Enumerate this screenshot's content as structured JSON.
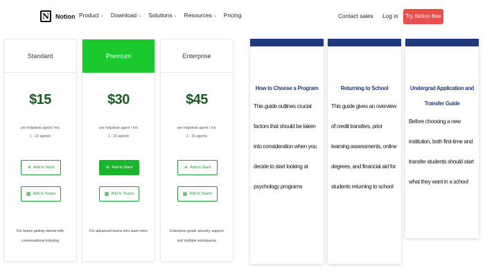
{
  "nav": {
    "logo_text": "Notion",
    "logo_glyph": "N",
    "menu": [
      {
        "label": "Product",
        "has_dropdown": true
      },
      {
        "label": "Download",
        "has_dropdown": true
      },
      {
        "label": "Solutions",
        "has_dropdown": true
      },
      {
        "label": "Resources",
        "has_dropdown": true
      },
      {
        "label": "Pricing",
        "has_dropdown": false
      }
    ],
    "chevron": "⌄",
    "contact_sales": "Contact sales",
    "login": "Log in",
    "cta": "Try Notion free"
  },
  "plans": [
    {
      "name": "Standard",
      "price": "$15",
      "sub_line1": "per helpdesk agent / mo",
      "sub_line2": "1 - 15 agents",
      "slack_label": "Add to Slack",
      "teams_label": "Add to Teams",
      "description": "For teams getting started with conversational ticketing"
    },
    {
      "name": "Premium",
      "price": "$30",
      "sub_line1": "per helpdesk agent / mo",
      "sub_line2": "1 - 15 agents",
      "slack_label": "Add to Slack",
      "teams_label": "Add to Teams",
      "description": "For advanced teams who want more"
    },
    {
      "name": "Enterprise",
      "price": "$45",
      "sub_line1": "per helpdesk agent / mo",
      "sub_line2": "1 - 15 agents",
      "slack_label": "Add to Slack",
      "teams_label": "Add to Teams",
      "description": "Enterprise-grade security, support and multiple workspaces"
    }
  ],
  "guides": [
    {
      "title": "How to Choose a Program",
      "body": "This guide outlines crucial factors that should be taken into consideration when you decide to start looking at psychology programs"
    },
    {
      "title": "Returning to School",
      "body": "This guide gives an overview of credit transfers, prior learning assessments, online degrees, and financial aid for students returning to school"
    },
    {
      "title": "Undergrad Application and Transfer Guide",
      "body": "Before choosing a new institution, both first-time and transfer students should start what they want in a school"
    }
  ],
  "colors": {
    "cta": "#e8504d",
    "premium_header": "#19c92d",
    "price": "#1a5a26",
    "guide_accent": "#1f3a7a"
  },
  "icons": {
    "slack": "slack-icon",
    "teams": "teams-icon"
  }
}
